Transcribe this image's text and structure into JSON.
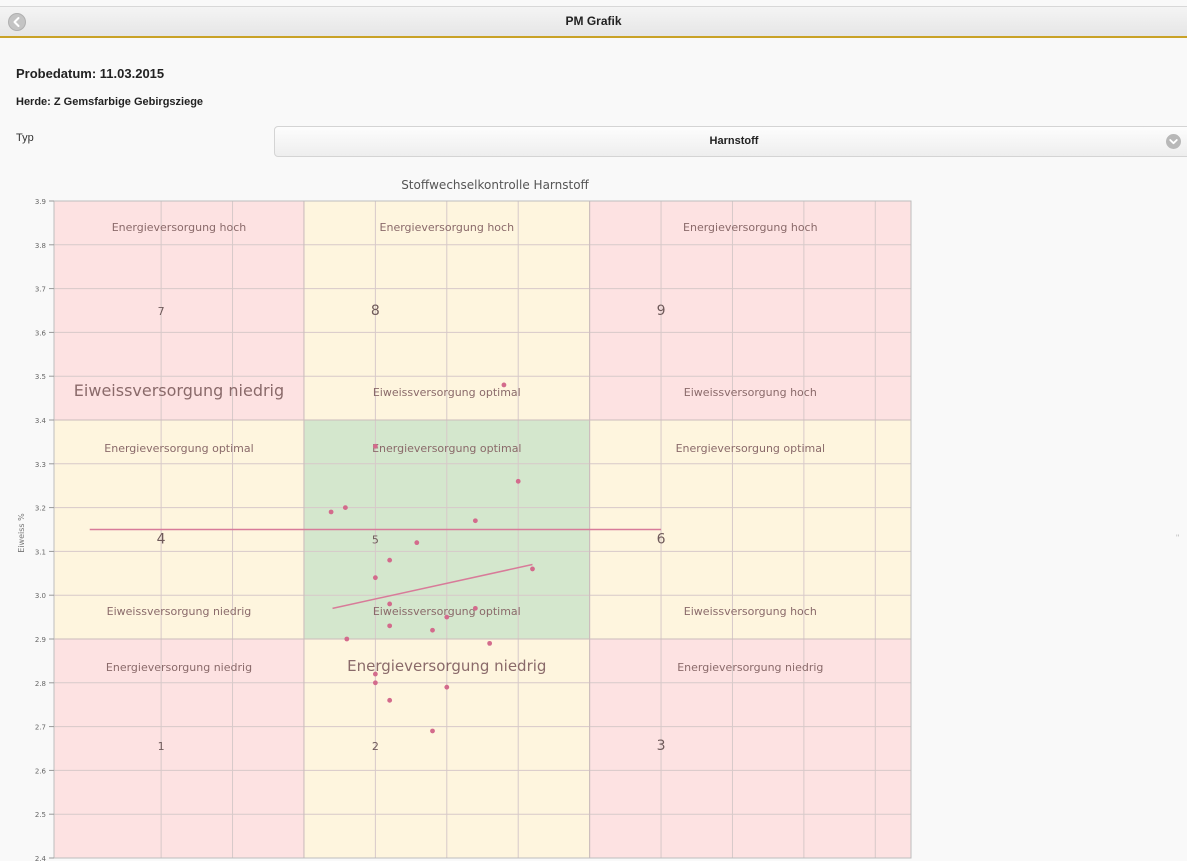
{
  "header": {
    "title": "PM Grafik",
    "back_icon": "chevron-left-icon"
  },
  "info": {
    "probedatum": "Probedatum: 11.03.2015",
    "herde": "Herde: Z Gemsfarbige Gebirgsziege"
  },
  "filter": {
    "label": "Typ",
    "selected": "Harnstoff",
    "dropdown_icon": "chevron-down-icon"
  },
  "colors": {
    "red_zone": "#fde2e2",
    "yellow_zone": "#fef5de",
    "green_zone": "#d4e7cd",
    "points": "#d36b8c",
    "lines": "#d87b99"
  },
  "chart_data": {
    "type": "scatter",
    "title": "Stoffwechselkontrolle Harnstoff",
    "ylabel": "Eiweiss %",
    "xlabel": "",
    "ylim": [
      2.4,
      3.9
    ],
    "yticks": [
      "2.4",
      "2.5",
      "2.6",
      "2.7",
      "2.8",
      "2.9",
      "3.0",
      "3.1",
      "3.2",
      "3.3",
      "3.4",
      "3.5",
      "3.6",
      "3.7",
      "3.8",
      "3.9"
    ],
    "grid": true,
    "points": [
      {
        "x": 0.0,
        "y": 3.34
      },
      {
        "x": -0.62,
        "y": 3.19
      },
      {
        "x": -0.42,
        "y": 3.2
      },
      {
        "x": 0.58,
        "y": 3.12
      },
      {
        "x": 1.4,
        "y": 3.17
      },
      {
        "x": 2.0,
        "y": 3.26
      },
      {
        "x": 1.8,
        "y": 3.48
      },
      {
        "x": 0.2,
        "y": 3.08
      },
      {
        "x": 0.0,
        "y": 3.04
      },
      {
        "x": 2.2,
        "y": 3.06
      },
      {
        "x": 0.2,
        "y": 2.98
      },
      {
        "x": 1.4,
        "y": 2.97
      },
      {
        "x": 1.0,
        "y": 2.95
      },
      {
        "x": 0.2,
        "y": 2.93
      },
      {
        "x": 0.8,
        "y": 2.92
      },
      {
        "x": -0.4,
        "y": 2.9
      },
      {
        "x": 1.6,
        "y": 2.89
      },
      {
        "x": 0.0,
        "y": 2.82
      },
      {
        "x": 0.0,
        "y": 2.8
      },
      {
        "x": 1.0,
        "y": 2.79
      },
      {
        "x": 0.2,
        "y": 2.76
      },
      {
        "x": 0.8,
        "y": 2.69
      }
    ],
    "lines": [
      {
        "points": [
          {
            "x": -4.0,
            "y": 3.15
          },
          {
            "x": 4.0,
            "y": 3.15
          }
        ]
      },
      {
        "points": [
          {
            "x": -0.6,
            "y": 2.97
          },
          {
            "x": 2.2,
            "y": 3.07
          }
        ]
      }
    ],
    "zones": [
      {
        "id": 7,
        "number": "7",
        "top": "Energieversorgung hoch",
        "bottom": "Eiweissversorgung niedrig",
        "color": "red"
      },
      {
        "id": 8,
        "number": "8",
        "top": "Energieversorgung hoch",
        "bottom": "Eiweissversorgung optimal",
        "color": "yellow"
      },
      {
        "id": 9,
        "number": "9",
        "top": "Energieversorgung hoch",
        "bottom": "Eiweissversorgung hoch",
        "color": "red"
      },
      {
        "id": 4,
        "number": "4",
        "top": "Energieversorgung optimal",
        "bottom": "Eiweissversorgung niedrig",
        "color": "yellow"
      },
      {
        "id": 5,
        "number": "5",
        "top": "Energieversorgung optimal",
        "bottom": "Eiweissversorgung optimal",
        "color": "green"
      },
      {
        "id": 6,
        "number": "6",
        "top": "Energieversorgung optimal",
        "bottom": "Eiweissversorgung hoch",
        "color": "yellow"
      },
      {
        "id": 1,
        "number": "1",
        "top": "Energieversorgung niedrig",
        "bottom": "Eiweissversorgung niedrig",
        "color": "red"
      },
      {
        "id": 2,
        "number": "2",
        "top": "Energieversorgung niedrig",
        "bottom": "Eiweissversorgung optimal",
        "color": "yellow"
      },
      {
        "id": 3,
        "number": "3",
        "top": "Energieversorgung niedrig",
        "bottom": "Eiweissversorgung hoch",
        "color": "red"
      }
    ]
  },
  "side_mark": "\""
}
